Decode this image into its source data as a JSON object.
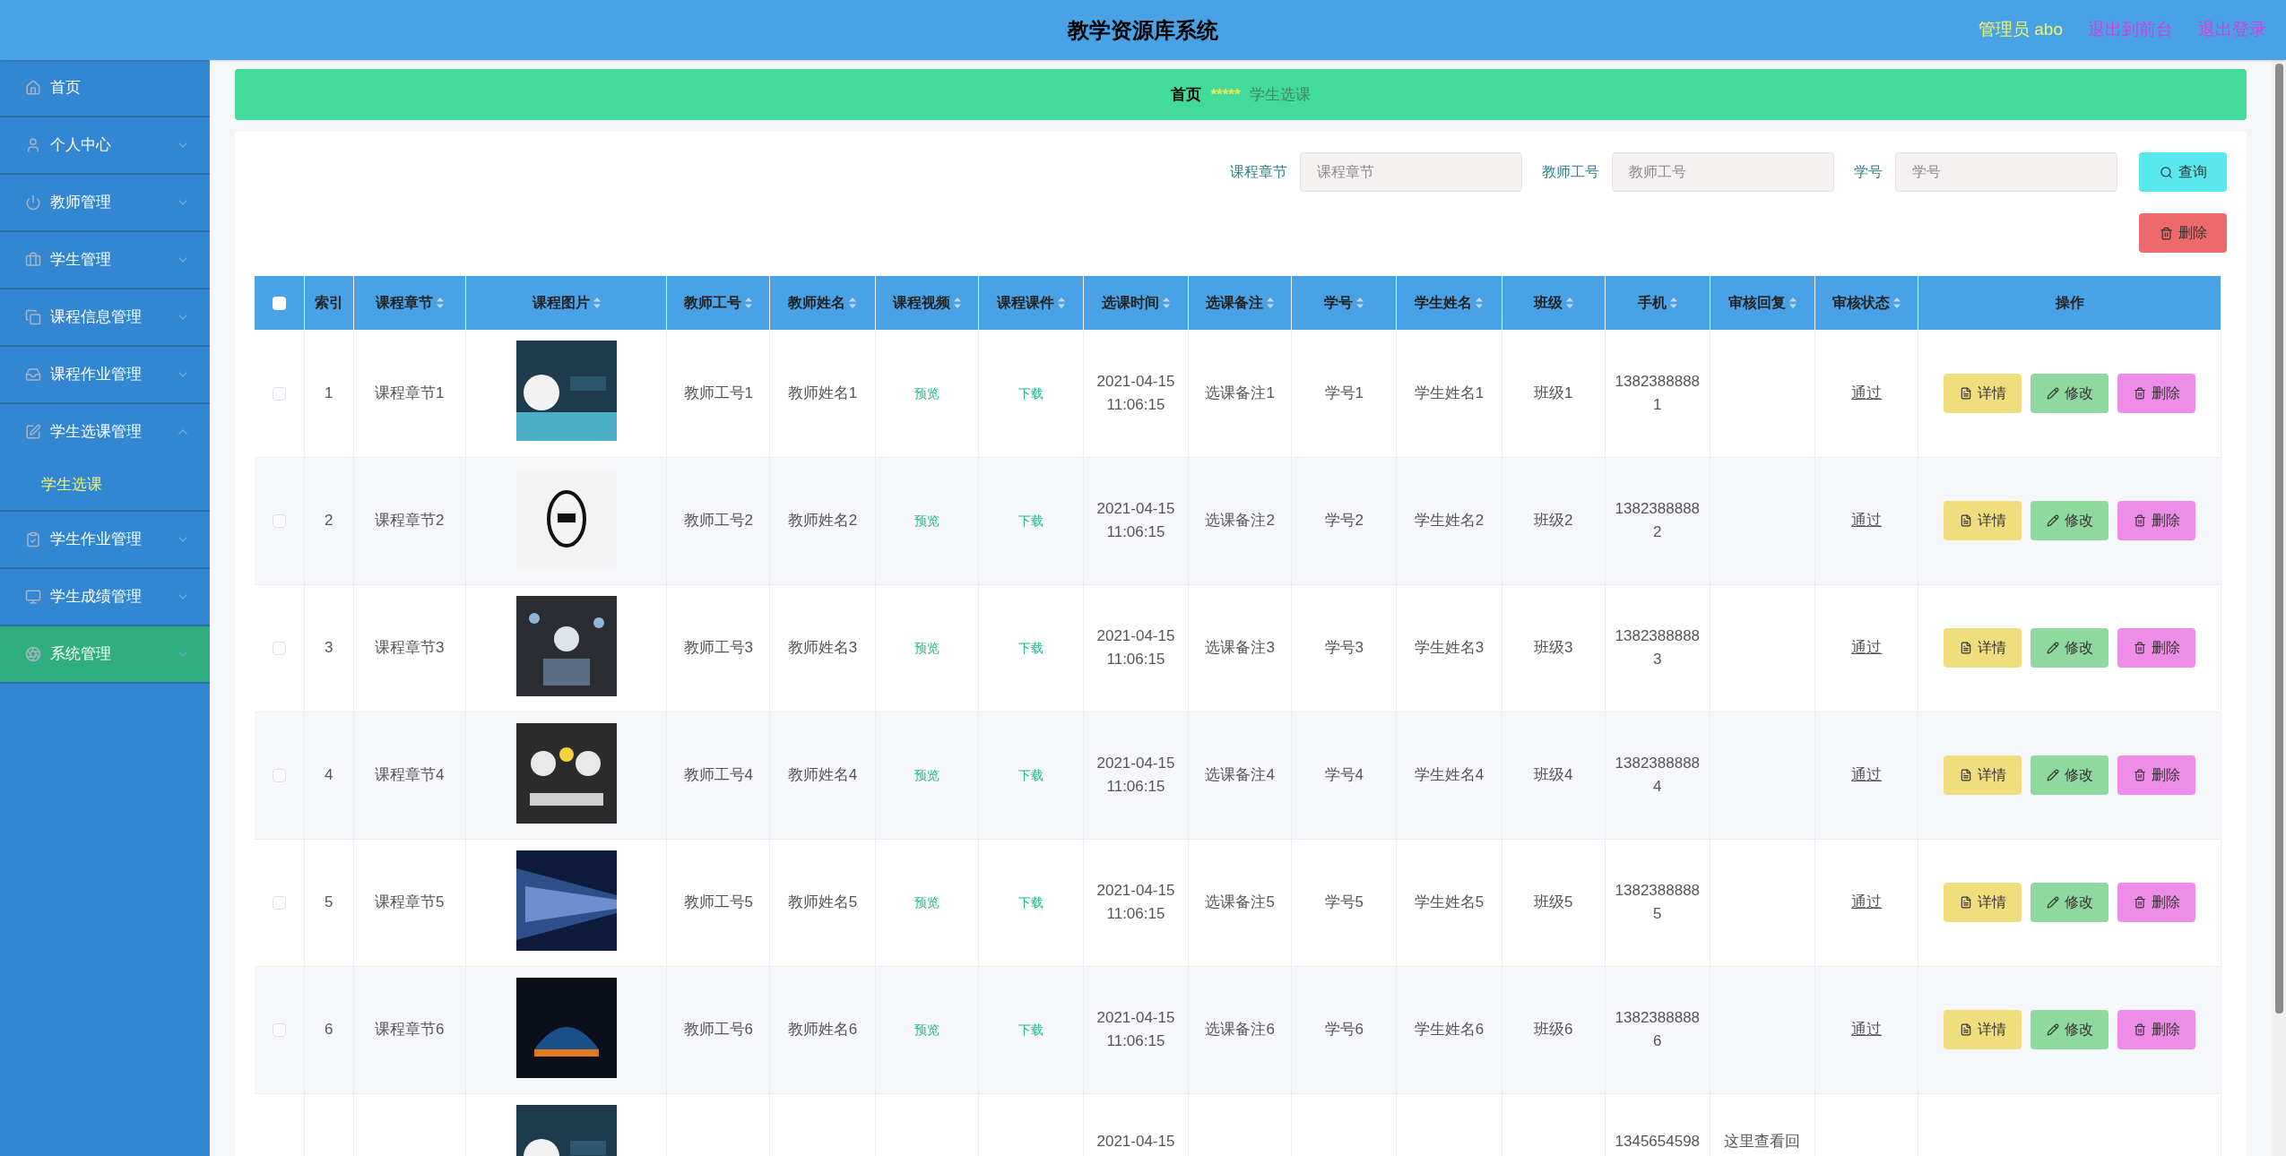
{
  "header": {
    "title": "教学资源库系统",
    "links": [
      {
        "label": "管理员 abo",
        "color": "#f4f46a"
      },
      {
        "label": "退出到前台",
        "color": "#d63be0"
      },
      {
        "label": "退出登录",
        "color": "#d63be0"
      }
    ]
  },
  "sidebar": {
    "items": [
      {
        "label": "首页",
        "expandable": false,
        "expanded": false,
        "highlighted": false
      },
      {
        "label": "个人中心",
        "expandable": true,
        "expanded": false,
        "highlighted": false
      },
      {
        "label": "教师管理",
        "expandable": true,
        "expanded": false,
        "highlighted": false
      },
      {
        "label": "学生管理",
        "expandable": true,
        "expanded": false,
        "highlighted": false
      },
      {
        "label": "课程信息管理",
        "expandable": true,
        "expanded": false,
        "highlighted": false
      },
      {
        "label": "课程作业管理",
        "expandable": true,
        "expanded": false,
        "highlighted": false
      },
      {
        "label": "学生选课管理",
        "expandable": true,
        "expanded": true,
        "highlighted": false,
        "children": [
          {
            "label": "学生选课",
            "selected": true
          }
        ]
      },
      {
        "label": "学生作业管理",
        "expandable": true,
        "expanded": false,
        "highlighted": false
      },
      {
        "label": "学生成绩管理",
        "expandable": true,
        "expanded": false,
        "highlighted": false
      },
      {
        "label": "系统管理",
        "expandable": true,
        "expanded": false,
        "highlighted": true
      }
    ]
  },
  "breadcrumb": {
    "items": [
      "首页",
      "学生选课"
    ],
    "separator": "*****"
  },
  "search": {
    "fields": [
      {
        "label": "课程章节",
        "placeholder": "课程章节"
      },
      {
        "label": "教师工号",
        "placeholder": "教师工号"
      },
      {
        "label": "学号",
        "placeholder": "学号"
      }
    ],
    "search_button": "查询",
    "delete_button": "删除"
  },
  "table": {
    "all_checked": false,
    "columns": [
      {
        "label": "索引",
        "sortable": false
      },
      {
        "label": "课程章节",
        "sortable": true
      },
      {
        "label": "课程图片",
        "sortable": true
      },
      {
        "label": "教师工号",
        "sortable": true
      },
      {
        "label": "教师姓名",
        "sortable": true
      },
      {
        "label": "课程视频",
        "sortable": true
      },
      {
        "label": "课程课件",
        "sortable": true
      },
      {
        "label": "选课时间",
        "sortable": true
      },
      {
        "label": "选课备注",
        "sortable": true
      },
      {
        "label": "学号",
        "sortable": true
      },
      {
        "label": "学生姓名",
        "sortable": true
      },
      {
        "label": "班级",
        "sortable": true
      },
      {
        "label": "手机",
        "sortable": true
      },
      {
        "label": "审核回复",
        "sortable": true
      },
      {
        "label": "审核状态",
        "sortable": true
      },
      {
        "label": "操作",
        "sortable": false
      }
    ],
    "rows": [
      {
        "checked": false,
        "index": "1",
        "chapter": "课程章节1",
        "teacher_id": "教师工号1",
        "teacher_name": "教师姓名1",
        "video": "预览",
        "courseware": "下载",
        "time": "2021-04-15 11:06:15",
        "remark": "选课备注1",
        "student_id": "学号1",
        "student_name": "学生姓名1",
        "class": "班级1",
        "phone": "13823888881",
        "status": "通过",
        "actions": [
          "详情",
          "修改",
          "删除"
        ]
      },
      {
        "checked": false,
        "index": "2",
        "chapter": "课程章节2",
        "teacher_id": "教师工号2",
        "teacher_name": "教师姓名2",
        "video": "预览",
        "courseware": "下载",
        "time": "2021-04-15 11:06:15",
        "remark": "选课备注2",
        "student_id": "学号2",
        "student_name": "学生姓名2",
        "class": "班级2",
        "phone": "13823888882",
        "status": "通过",
        "actions": [
          "详情",
          "修改",
          "删除"
        ]
      },
      {
        "checked": false,
        "index": "3",
        "chapter": "课程章节3",
        "teacher_id": "教师工号3",
        "teacher_name": "教师姓名3",
        "video": "预览",
        "courseware": "下载",
        "time": "2021-04-15 11:06:15",
        "remark": "选课备注3",
        "student_id": "学号3",
        "student_name": "学生姓名3",
        "class": "班级3",
        "phone": "13823888883",
        "status": "通过",
        "actions": [
          "详情",
          "修改",
          "删除"
        ]
      },
      {
        "checked": false,
        "index": "4",
        "chapter": "课程章节4",
        "teacher_id": "教师工号4",
        "teacher_name": "教师姓名4",
        "video": "预览",
        "courseware": "下载",
        "time": "2021-04-15 11:06:15",
        "remark": "选课备注4",
        "student_id": "学号4",
        "student_name": "学生姓名4",
        "class": "班级4",
        "phone": "13823888884",
        "status": "通过",
        "actions": [
          "详情",
          "修改",
          "删除"
        ]
      },
      {
        "checked": false,
        "index": "5",
        "chapter": "课程章节5",
        "teacher_id": "教师工号5",
        "teacher_name": "教师姓名5",
        "video": "预览",
        "courseware": "下载",
        "time": "2021-04-15 11:06:15",
        "remark": "选课备注5",
        "student_id": "学号5",
        "student_name": "学生姓名5",
        "class": "班级5",
        "phone": "13823888885",
        "status": "通过",
        "actions": [
          "详情",
          "修改",
          "删除"
        ]
      },
      {
        "checked": false,
        "index": "6",
        "chapter": "课程章节6",
        "teacher_id": "教师工号6",
        "teacher_name": "教师姓名6",
        "video": "预览",
        "courseware": "下载",
        "time": "2021-04-15 11:06:15",
        "remark": "选课备注6",
        "student_id": "学号6",
        "student_name": "学生姓名6",
        "class": "班级6",
        "phone": "13823888886",
        "status": "通过",
        "actions": [
          "详情",
          "修改",
          "删除"
        ]
      },
      {
        "time": "2021-04-15",
        "phone": "1345654598",
        "reply": "这里查看回"
      }
    ]
  }
}
